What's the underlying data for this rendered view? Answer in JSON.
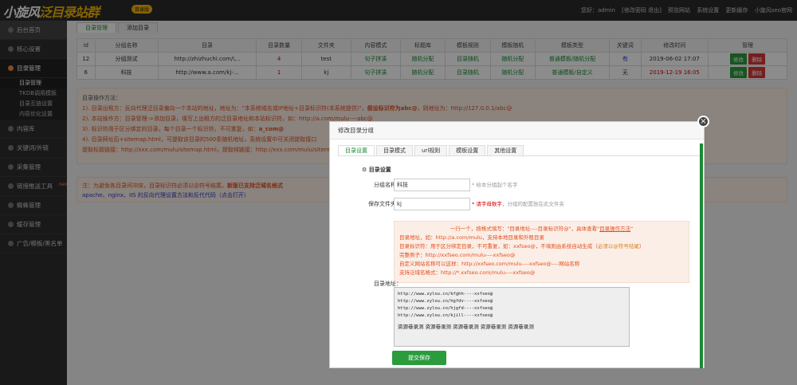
{
  "header": {
    "logo_main": "小旋风",
    "logo_sub": "泛目录站群",
    "logo_tag": "目录版",
    "links": [
      "您好：admin",
      "[修改密码 退出]",
      "预览网站",
      "系统设置",
      "更新缓存",
      "小旋风seo官网"
    ]
  },
  "sidebar": {
    "items": [
      {
        "label": "后台首页"
      },
      {
        "label": "核心设置"
      },
      {
        "label": "目录管理"
      },
      {
        "label": "内容库"
      },
      {
        "label": "关键词/外链"
      },
      {
        "label": "采集管理"
      },
      {
        "label": "链接推送工具",
        "badge": "new"
      },
      {
        "label": "蜘蛛管理"
      },
      {
        "label": "缓存管理"
      },
      {
        "label": "广告/模板/黑名单"
      }
    ],
    "sub_items": [
      "目录管理",
      "TKDB调用模板",
      "目录互链设置",
      "内容优化设置"
    ]
  },
  "tabs": [
    "目录管理",
    "添加目录"
  ],
  "table": {
    "headers": [
      "id",
      "分组名称",
      "目录",
      "目录数量",
      "文件夹",
      "内容模式",
      "标题库",
      "模板规则",
      "模板随机",
      "模板类型",
      "关键词",
      "修改时间",
      "管理"
    ],
    "rows": [
      {
        "id": "12",
        "name": "分组测试",
        "dir": "http://zhizhuchi.com/\\...",
        "count": "4",
        "folder": "test",
        "mode": "句子拼凑",
        "title_lib": "随机分配",
        "rule": "目录随机",
        "random": "随机分配",
        "type": "普通模板/随机分配",
        "keyword": "有",
        "time": "2019-06-02 17:07",
        "edit": "修改",
        "del": "删除"
      },
      {
        "id": "6",
        "name": "科技",
        "dir": "http://www.a.com/kj-...",
        "count": "1",
        "folder": "kj",
        "mode": "句子拼凑",
        "title_lib": "随机分配",
        "rule": "目录随机",
        "random": "随机分配",
        "type": "普通模板/自定义",
        "keyword": "无",
        "time": "2019-12-19 16:05",
        "edit": "修改",
        "del": "删除"
      }
    ]
  },
  "info": {
    "title": "目录操作方法：",
    "l1a": "1). 目录出租方：反向代理泛目录偏向一个本站的地址，地址为：\"本系统域名或IP地址+目录标识符(本系统提供)\"，",
    "l1b": "假设标识符为abc@",
    "l1c": "，则地址为：http://127.0.0.1/abc@",
    "l2": "2). 本站操作方：目录管理->添加目录，填写上出租方的泛目录地址和本站标识符，如：http://a.com/mulu----abc@",
    "l3a": "3). 标识符用于区分绑定的目录，每个目录一个标识符，不可重复，如：",
    "l3b": "a_com@",
    "l4": "4). 目录网址后+sitemap.html，可提取该目录的500条随机地址，系统设置中可关闭提取接口",
    "l5": "提取标题链接：http://xxx.com/mulu/sitemap.html，提取纯链接：http://xxx.com/mulu/sitemap..."
  },
  "note": {
    "l1a": "注：为避免各目录间冲突，目录标识符必须以@符号结尾，",
    "l1b": "新版已支持泛域名格式",
    "l2": "apache、nginx、IIS 的反向代理设置方法和反代代码（点击打开）"
  },
  "modal": {
    "title": "修改目录分组",
    "tabs": [
      "目录设置",
      "目录模式",
      "url规则",
      "模板设置",
      "其他设置"
    ],
    "section": "目录设置",
    "group_label": "分组名称：",
    "group_value": "科技",
    "group_hint": "* 给本分组起个名字",
    "folder_label": "保存文件夹：",
    "folder_value": "kj",
    "folder_hint_red": "* 请字母数字",
    "folder_hint": "，分组的配置放在此文件夹",
    "dir_label": "目录地址：",
    "tip": {
      "head_a": "一行一个，按格式填写：\"目录地址----目录标识符@\"，具体查看\"",
      "head_link": "目录操作方法",
      "head_b": "\"",
      "l1": "目录地址，如：http://a.com/mulu，支持本地目录和外租目录",
      "l2a": "目录标识符：用于区分绑定目录，不可重复，如：xxfseo@，不填则由系统自动生成（",
      "l2b": "必须以@符号结尾",
      "l2c": "）",
      "l3": "完整例子：http://xxfseo.com/mulu----xxfseo@",
      "l4": "自定义网站名称可以这样：http://xxfseo.com/mulu----xxfseo@----网站名称",
      "l5": "支持泛域名格式：http://*.xxfseo.com/mulu----xxfseo@"
    },
    "textarea_lines": [
      "http://www.zylou.cn/kfghh----xxfseo@",
      "http://www.zylou.cn/hgfdv----xxfseo@",
      "http://www.zylou.cn/hjgfd----xxfseo@",
      "http://www.zylou.cn/kjill----xxfseo@"
    ],
    "textarea_tail": "资源巷录测 资源巷录测 资源巷录测 资源巷录测 资源巷录测",
    "submit": "提交保存",
    "close": "×"
  }
}
